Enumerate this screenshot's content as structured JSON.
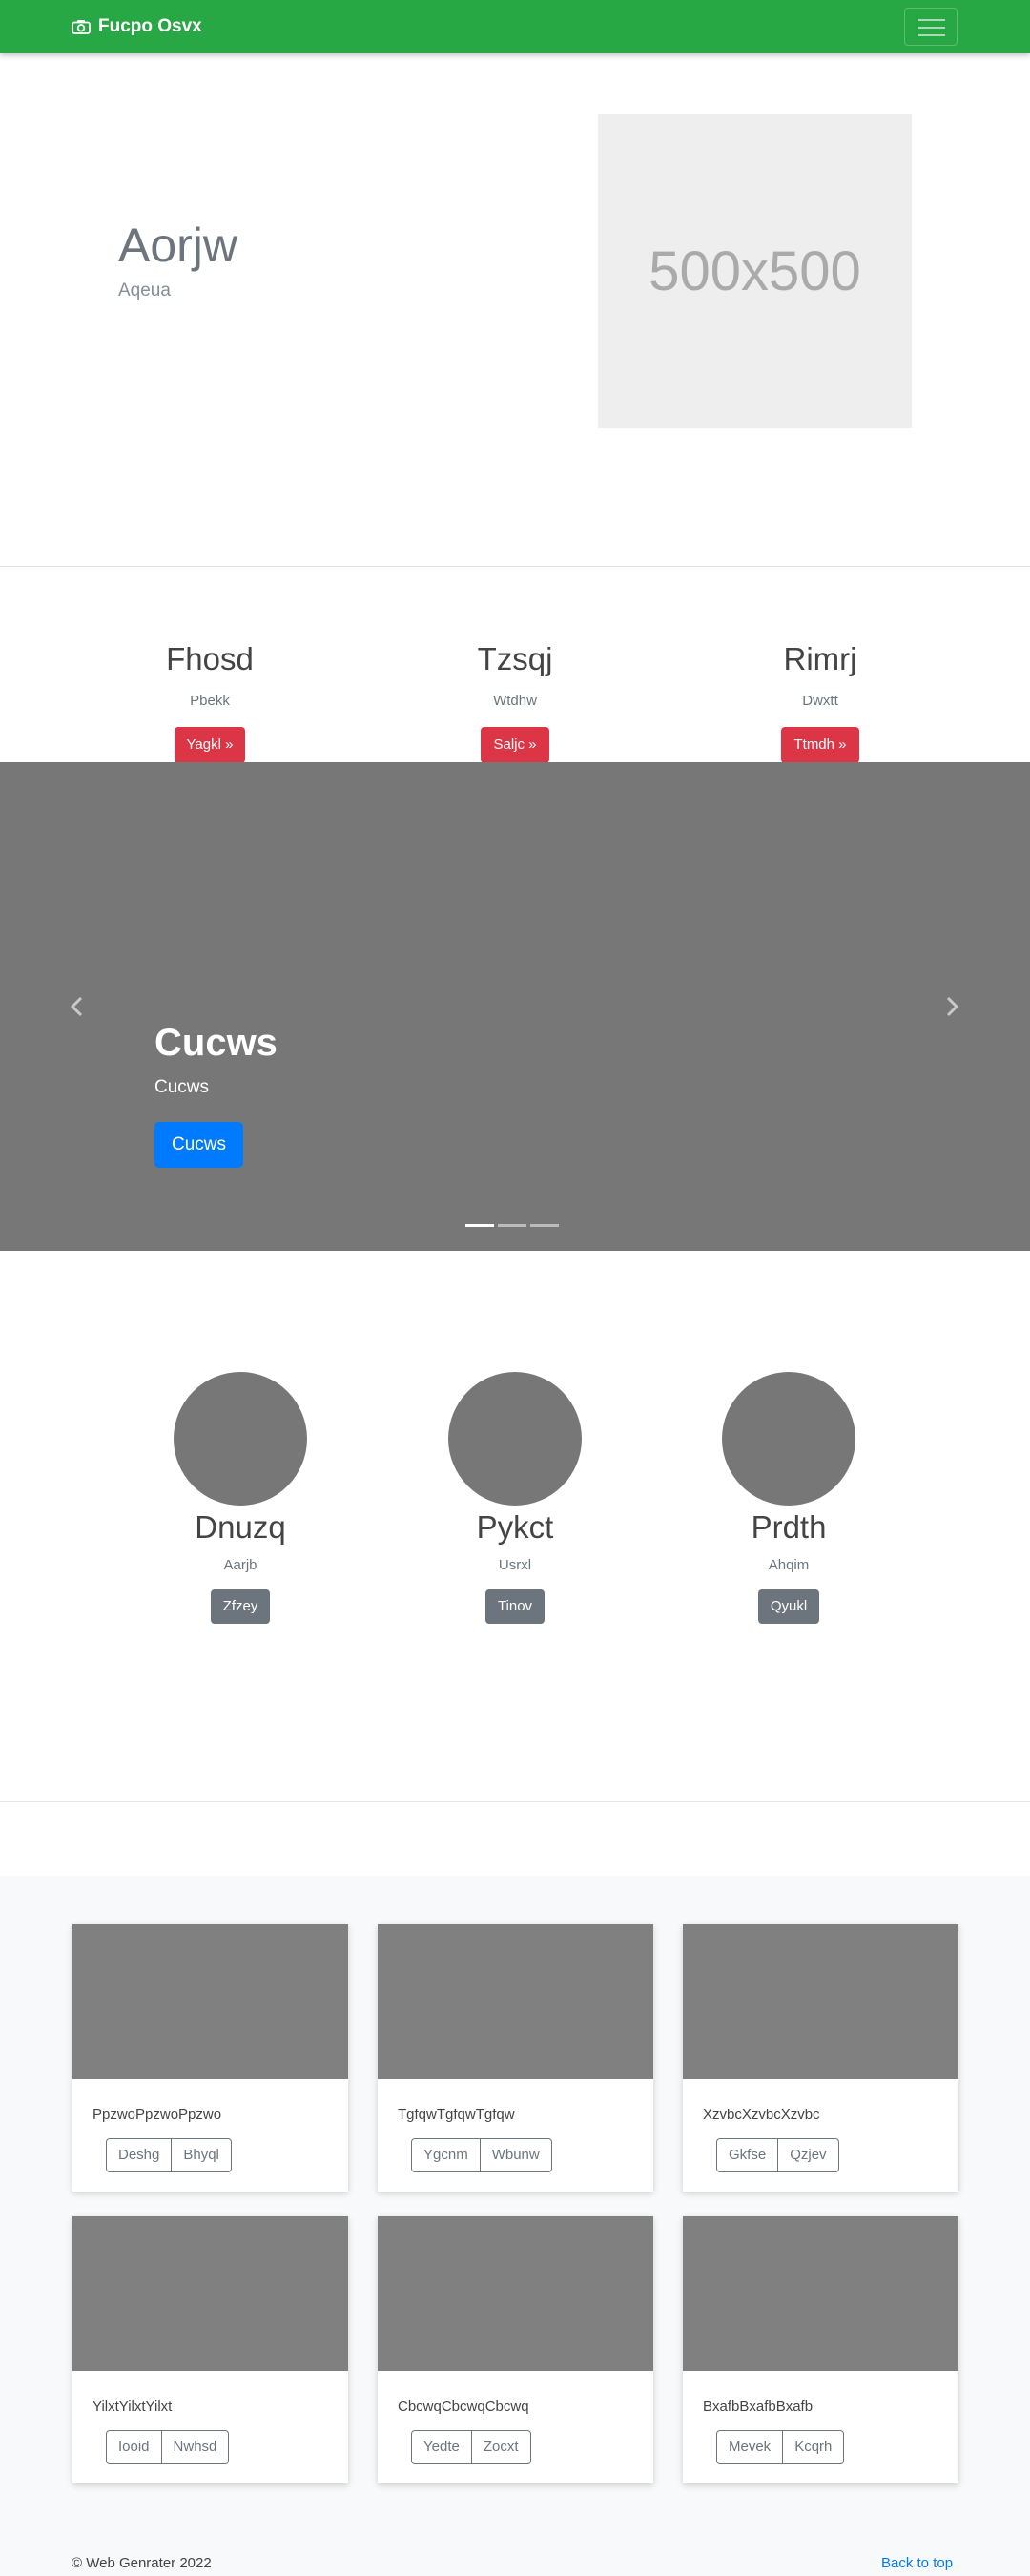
{
  "navbar": {
    "brand": "Fucpo Osvx",
    "brand_icon": "camera-icon"
  },
  "hero": {
    "title": "Aorjw",
    "subtitle": "Aqeua",
    "image_placeholder": "500x500"
  },
  "features": [
    {
      "title": "Fhosd",
      "text": "Pbekk",
      "button": "Yagkl »"
    },
    {
      "title": "Tzsqj",
      "text": "Wtdhw",
      "button": "Saljc »"
    },
    {
      "title": "Rimrj",
      "text": "Dwxtt",
      "button": "Ttmdh »"
    }
  ],
  "carousel": {
    "title": "Cucws",
    "subtitle": "Cucws",
    "button": "Cucws",
    "slide_count": 3,
    "active_slide": 1
  },
  "team": [
    {
      "name": "Dnuzq",
      "text": "Aarjb",
      "button": "Zfzey"
    },
    {
      "name": "Pykct",
      "text": "Usrxl",
      "button": "Tinov"
    },
    {
      "name": "Prdth",
      "text": "Ahqim",
      "button": "Qyukl"
    }
  ],
  "cards": [
    {
      "text": "PpzwoPpzwoPpzwo",
      "btn1": "Deshg",
      "btn2": "Bhyql"
    },
    {
      "text": "TgfqwTgfqwTgfqw",
      "btn1": "Ygcnm",
      "btn2": "Wbunw"
    },
    {
      "text": "XzvbcXzvbcXzvbc",
      "btn1": "Gkfse",
      "btn2": "Qzjev"
    },
    {
      "text": "YilxtYilxtYilxt",
      "btn1": "Iooid",
      "btn2": "Nwhsd"
    },
    {
      "text": "CbcwqCbcwqCbcwq",
      "btn1": "Yedte",
      "btn2": "Zocxt"
    },
    {
      "text": "BxafbBxafbBxafb",
      "btn1": "Mevek",
      "btn2": "Kcqrh"
    }
  ],
  "footer": {
    "copyright": "© Web Genrater 2022",
    "back_to_top": "Back to top"
  },
  "colors": {
    "navbar": "#28a745",
    "danger": "#dc3545",
    "primary": "#007bff",
    "secondary": "#6c757d",
    "placeholder": "#777777"
  }
}
